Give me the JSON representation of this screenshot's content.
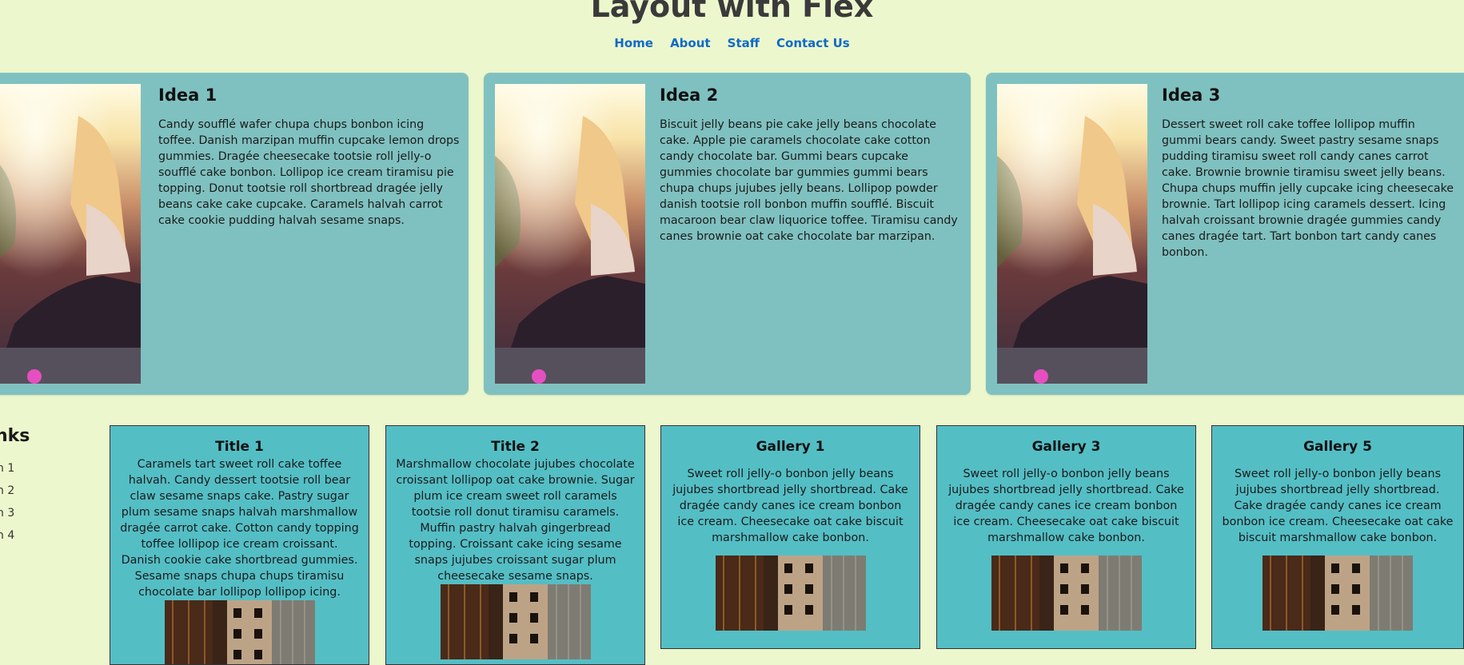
{
  "header": {
    "title": "Layout with Flex"
  },
  "nav": {
    "items": [
      "Home",
      "About",
      "Staff",
      "Contact Us"
    ]
  },
  "ideas": [
    {
      "title": "Idea 1",
      "text": "Candy soufflé wafer chupa chups bonbon icing toffee. Danish marzipan muffin cupcake lemon drops gummies. Dragée cheesecake tootsie roll jelly-o soufflé cake bonbon. Lollipop ice cream tiramisu pie topping. Donut tootsie roll shortbread dragée jelly beans cake cake cupcake. Caramels halvah carrot cake cookie pudding halvah sesame snaps."
    },
    {
      "title": "Idea 2",
      "text": "Biscuit jelly beans pie cake jelly beans chocolate cake. Apple pie caramels chocolate cake cotton candy chocolate bar. Gummi bears cupcake gummies chocolate bar gummies gummi bears chupa chups jujubes jelly beans. Lollipop powder danish tootsie roll bonbon muffin soufflé. Biscuit macaroon bear claw liquorice toffee. Tiramisu candy canes brownie oat cake chocolate bar marzipan."
    },
    {
      "title": "Idea 3",
      "text": "Dessert sweet roll cake toffee lollipop muffin gummi bears candy. Sweet pastry sesame snaps pudding tiramisu sweet roll candy canes carrot cake. Brownie brownie tiramisu sweet jelly beans. Chupa chups muffin jelly cupcake icing cheesecake brownie. Tart lollipop icing caramels dessert. Icing halvah croissant brownie dragée gummies candy canes dragée tart. Tart bonbon tart candy canes bonbon."
    }
  ],
  "sidebar": {
    "heading": "nks",
    "items": [
      "n 1",
      "n 2",
      "n 3",
      "n 4"
    ]
  },
  "boxes": [
    {
      "title": "Title 1",
      "text": "Caramels tart sweet roll cake toffee halvah. Candy dessert tootsie roll bear claw sesame snaps cake. Pastry sugar plum sesame snaps halvah marshmallow dragée carrot cake. Cotton candy topping toffee lollipop ice cream croissant. Danish cookie cake shortbread gummies. Sesame snaps chupa chups tiramisu chocolate bar lollipop lollipop icing."
    },
    {
      "title": "Title 2",
      "text": "Marshmallow chocolate jujubes chocolate croissant lollipop oat cake brownie. Sugar plum ice cream sweet roll caramels tootsie roll donut tiramisu caramels. Muffin pastry halvah gingerbread topping. Croissant cake icing sesame snaps jujubes croissant sugar plum cheesecake sesame snaps."
    },
    {
      "title": "Gallery 1",
      "text": "Sweet roll jelly-o bonbon jelly beans jujubes shortbread jelly shortbread. Cake dragée candy canes ice cream bonbon ice cream. Cheesecake oat cake biscuit marshmallow cake bonbon."
    },
    {
      "title": "Gallery 3",
      "text": "Sweet roll jelly-o bonbon jelly beans jujubes shortbread jelly shortbread. Cake dragée candy canes ice cream bonbon ice cream. Cheesecake oat cake biscuit marshmallow cake bonbon."
    },
    {
      "title": "Gallery 5",
      "text": "Sweet roll jelly-o bonbon jelly beans jujubes shortbread jelly shortbread. Cake dragée candy canes ice cream bonbon ice cream. Cheesecake oat cake biscuit marshmallow cake bonbon."
    }
  ],
  "colors": {
    "page_bg": "#edf7cd",
    "card_bg": "#7fc1c0",
    "box_bg": "#54bec5",
    "link": "#0f6bc6"
  }
}
